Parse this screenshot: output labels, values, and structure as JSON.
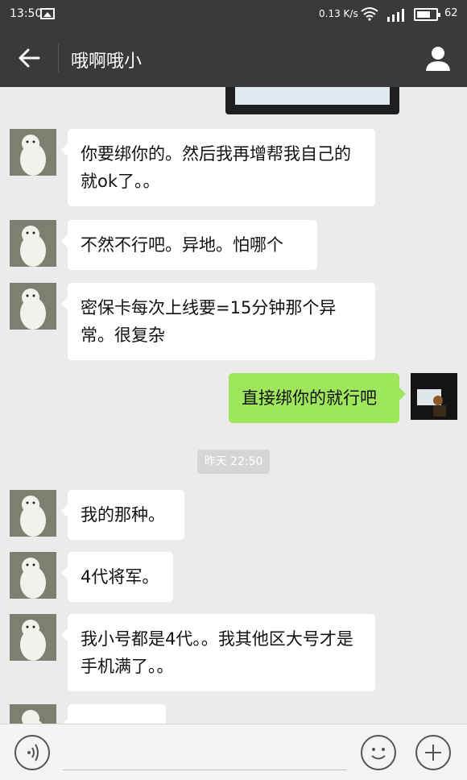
{
  "status": {
    "time": "13:50",
    "speed": "0.13 K/s",
    "battery": "62"
  },
  "header": {
    "title": "哦啊哦小"
  },
  "messages": [
    {
      "side": "left",
      "text": "你要绑你的。然后我再增帮我自己的就ok了。。"
    },
    {
      "side": "left",
      "text": "不然不行吧。异地。怕哪个"
    },
    {
      "side": "left",
      "text": "密保卡每次上线要=15分钟那个异常。很复杂"
    },
    {
      "side": "right",
      "text": "直接绑你的就行吧"
    },
    {
      "side": "left",
      "text": "我的那种。"
    },
    {
      "side": "left",
      "text": "4代将军。"
    },
    {
      "side": "left",
      "text": "我小号都是4代。。我其他区大号才是手机满了。。"
    }
  ],
  "timestamp": "昨天 22:50",
  "colors": {
    "bar": "#3a3a3c",
    "chat_bg": "#ebebeb",
    "mine_bubble": "#9ee65b"
  }
}
